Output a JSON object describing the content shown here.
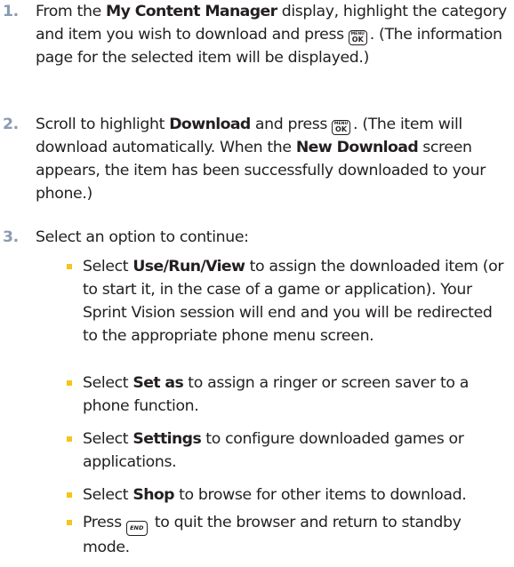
{
  "steps": [
    {
      "number": "1.",
      "pre_bold": "From the ",
      "bold": "My Content Manager",
      "post_bold": " display, highlight the category and item you wish to download and press",
      "key": "MENU OK",
      "key_line1": "MENU",
      "key_line2": "OK",
      "after_key": ". (The information page for the selected item will be displayed.)"
    },
    {
      "number": "2.",
      "pre_bold": "Scroll to highlight ",
      "bold": "Download",
      "post_bold": " and press",
      "key": "MENU OK",
      "key_line1": "MENU",
      "key_line2": "OK",
      "after_key": ". (The item will download automatically. When the ",
      "bold2": "New Download",
      "after_bold2": " screen appears, the item has been successfully downloaded to your phone.)"
    },
    {
      "number": "3.",
      "text": "Select an option to continue:"
    }
  ],
  "options": [
    {
      "pre_bold": "Select ",
      "bold": "Use/Run/View",
      "post_bold": " to assign the downloaded item (or to start it, in the case of a game or application). Your Sprint Vision session will end and you will be redirected to the appropriate phone menu screen."
    },
    {
      "pre_bold": "Select ",
      "bold": "Set as",
      "post_bold": " to assign a ringer or screen saver to a phone function."
    },
    {
      "pre_bold": "Select ",
      "bold": "Settings",
      "post_bold": " to configure downloaded games or applications."
    },
    {
      "pre_bold": "Select ",
      "bold": "Shop",
      "post_bold": " to browse for other items to download."
    },
    {
      "pre": "Press",
      "key": "END",
      "key_label": "END",
      "post": " to quit the browser and return to standby mode."
    }
  ],
  "colors": {
    "step_number": "#8a9bb1",
    "bullet": "#f5c518",
    "text": "#231f20"
  }
}
